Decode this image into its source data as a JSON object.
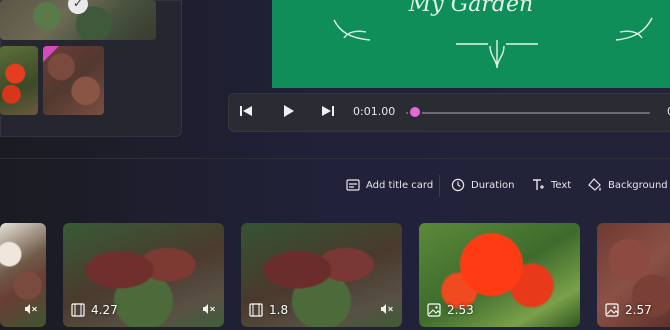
{
  "preview": {
    "title_card_text": "My Garden",
    "background_color": "#0f8e5a"
  },
  "player": {
    "current_time": "0:01.00",
    "end_time_partial": "0",
    "progress_fraction": 0.02
  },
  "toolbar": {
    "add_title_card": "Add title card",
    "duration": "Duration",
    "text": "Text",
    "background": "Background"
  },
  "storyboard": [
    {
      "duration": "",
      "type": "video",
      "muted": true
    },
    {
      "duration": "4.27",
      "type": "video",
      "muted": true
    },
    {
      "duration": "1.8",
      "type": "video",
      "muted": true
    },
    {
      "duration": "2.53",
      "type": "image",
      "muted": false
    },
    {
      "duration": "2.57",
      "type": "image",
      "muted": false
    }
  ],
  "colors": {
    "accent": "#e26ad0",
    "title_card_green": "#0f8e5a"
  },
  "icons": [
    "previous-frame-icon",
    "play-icon",
    "next-frame-icon",
    "title-card-icon",
    "clock-icon",
    "text-icon",
    "background-icon",
    "video-clip-icon",
    "image-icon",
    "mute-icon",
    "checkmark-icon"
  ]
}
